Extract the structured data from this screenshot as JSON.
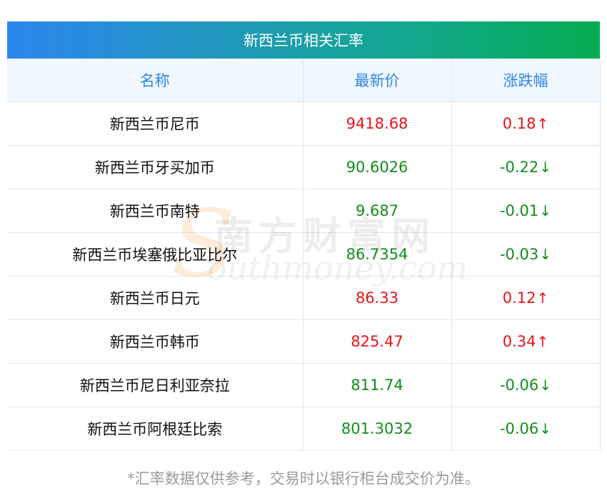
{
  "banner_title": "新西兰币相关汇率",
  "columns": [
    "名称",
    "最新价",
    "涨跌幅"
  ],
  "rows": [
    {
      "name": "新西兰币尼币",
      "price": "9418.68",
      "change": "0.18",
      "arrow": "↑",
      "dir": "up"
    },
    {
      "name": "新西兰币牙买加币",
      "price": "90.6026",
      "change": "-0.22",
      "arrow": "↓",
      "dir": "down"
    },
    {
      "name": "新西兰币南特",
      "price": "9.687",
      "change": "-0.01",
      "arrow": "↓",
      "dir": "down"
    },
    {
      "name": "新西兰币埃塞俄比亚比尔",
      "price": "86.7354",
      "change": "-0.03",
      "arrow": "↓",
      "dir": "down"
    },
    {
      "name": "新西兰币日元",
      "price": "86.33",
      "change": "0.12",
      "arrow": "↑",
      "dir": "up"
    },
    {
      "name": "新西兰币韩币",
      "price": "825.47",
      "change": "0.34",
      "arrow": "↑",
      "dir": "up"
    },
    {
      "name": "新西兰币尼日利亚奈拉",
      "price": "811.74",
      "change": "-0.06",
      "arrow": "↓",
      "dir": "down"
    },
    {
      "name": "新西兰币阿根廷比索",
      "price": "801.3032",
      "change": "-0.06",
      "arrow": "↓",
      "dir": "down"
    }
  ],
  "footnote": "*汇率数据仅供参考，交易时以银行柜台成交价为准。",
  "watermark": {
    "logo_cn": "南方财富网",
    "logo_en": "outhmoney.com",
    "logo_s": "S"
  },
  "colors": {
    "up": "#e8141a",
    "down": "#138c1d",
    "header_text": "#2c86e6",
    "banner_start": "#2d86f0",
    "banner_end": "#05ab52"
  }
}
